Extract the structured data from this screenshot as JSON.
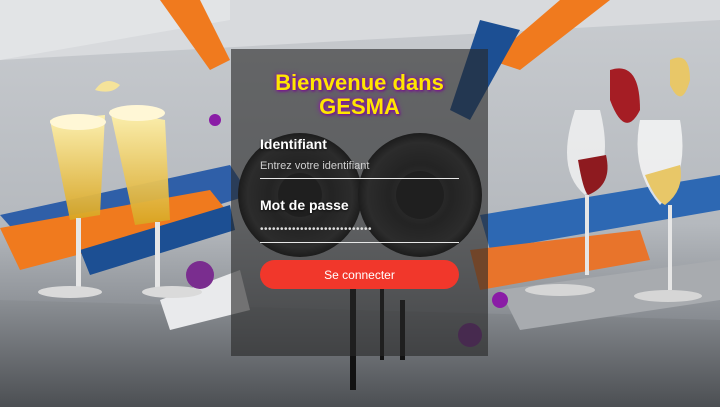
{
  "login": {
    "title": "Bienvenue dans GESMA",
    "username_label": "Identifiant",
    "username_placeholder": "Entrez votre identifiant",
    "password_label": "Mot de passe",
    "password_value": "••••••••••••••••••••••••••••",
    "submit_label": "Se connecter"
  },
  "colors": {
    "title": "#ffe600",
    "button": "#f1372b",
    "card": "rgba(40,40,40,0.62)"
  },
  "icons": [
    "champagne-glasses-icon",
    "speakers-icon",
    "wine-glasses-icon"
  ]
}
